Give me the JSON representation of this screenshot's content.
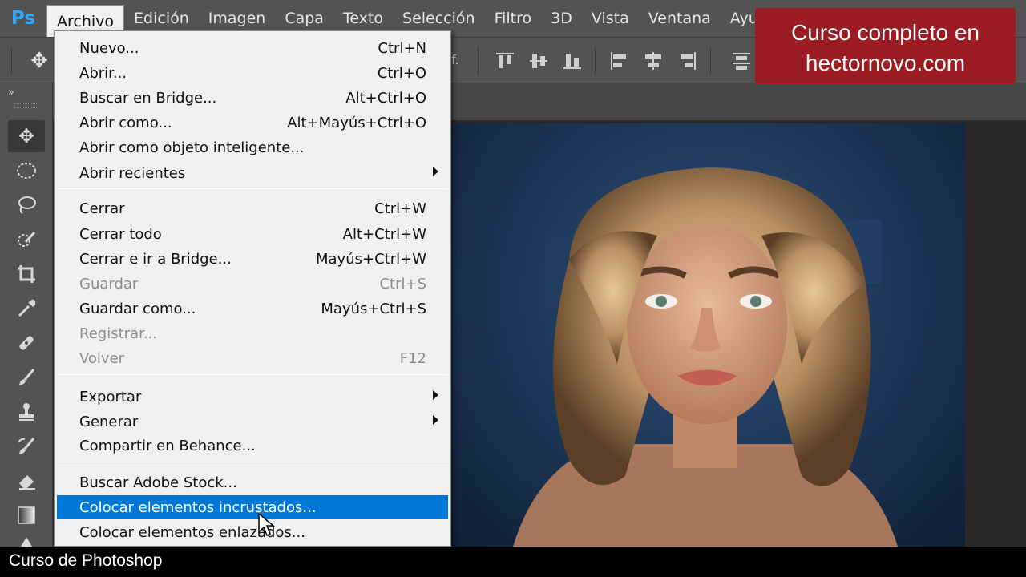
{
  "app": {
    "logo": "Ps"
  },
  "menubar": {
    "items": [
      "Archivo",
      "Edición",
      "Imagen",
      "Capa",
      "Texto",
      "Selección",
      "Filtro",
      "3D",
      "Vista",
      "Ventana",
      "Ayuda"
    ]
  },
  "optionsbar": {
    "partial_text": "f."
  },
  "toolbar": {
    "collapse_glyph": "»"
  },
  "file_menu": {
    "items": [
      {
        "label": "Nuevo...",
        "shortcut": "Ctrl+N"
      },
      {
        "label": "Abrir...",
        "shortcut": "Ctrl+O"
      },
      {
        "label": "Buscar en Bridge...",
        "shortcut": "Alt+Ctrl+O"
      },
      {
        "label": "Abrir como...",
        "shortcut": "Alt+Mayús+Ctrl+O"
      },
      {
        "label": "Abrir como objeto inteligente...",
        "shortcut": ""
      },
      {
        "label": "Abrir recientes",
        "shortcut": ""
      },
      {
        "label": "Cerrar",
        "shortcut": "Ctrl+W"
      },
      {
        "label": "Cerrar todo",
        "shortcut": "Alt+Ctrl+W"
      },
      {
        "label": "Cerrar e ir a Bridge...",
        "shortcut": "Mayús+Ctrl+W"
      },
      {
        "label": "Guardar",
        "shortcut": "Ctrl+S"
      },
      {
        "label": "Guardar como...",
        "shortcut": "Mayús+Ctrl+S"
      },
      {
        "label": "Registrar...",
        "shortcut": ""
      },
      {
        "label": "Volver",
        "shortcut": "F12"
      },
      {
        "label": "Exportar",
        "shortcut": ""
      },
      {
        "label": "Generar",
        "shortcut": ""
      },
      {
        "label": "Compartir en Behance...",
        "shortcut": ""
      },
      {
        "label": "Buscar Adobe Stock...",
        "shortcut": ""
      },
      {
        "label": "Colocar elementos incrustados...",
        "shortcut": ""
      },
      {
        "label": "Colocar elementos enlazados...",
        "shortcut": ""
      }
    ]
  },
  "promo": {
    "line1": "Curso completo en",
    "line2": "hectornovo.com"
  },
  "footer": {
    "text": "Curso de Photoshop"
  },
  "colors": {
    "accent": "#31a8ff",
    "highlight": "#0078d7",
    "promo_bg": "#9b1c22",
    "ui_bg": "#535353"
  }
}
